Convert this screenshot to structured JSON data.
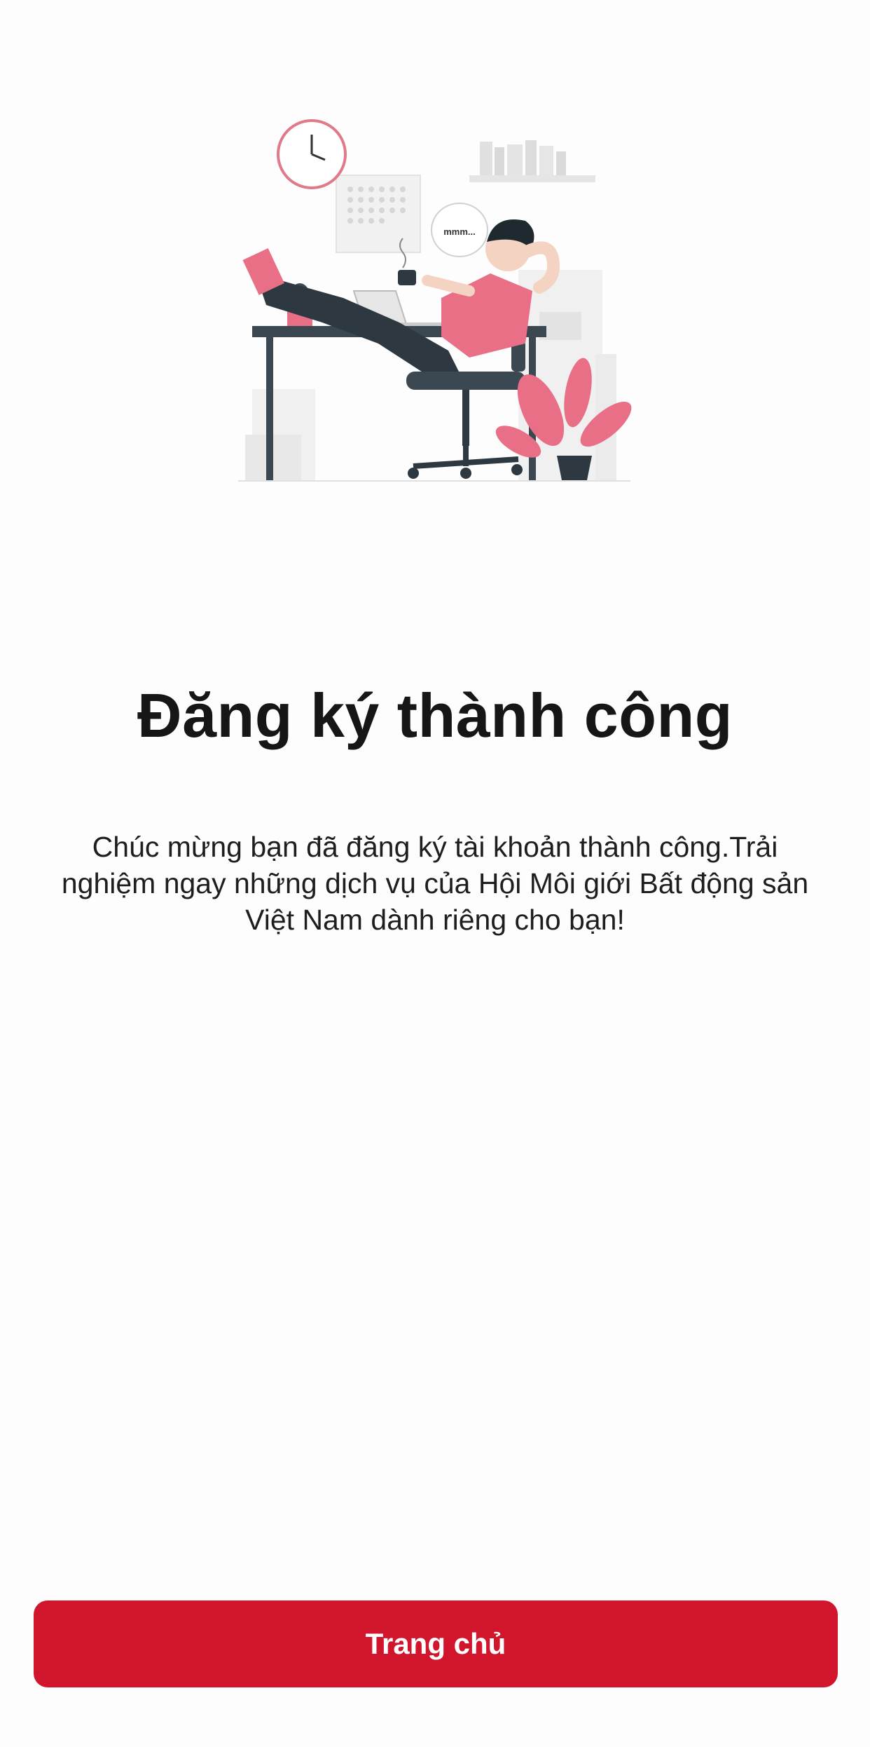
{
  "illustration": {
    "icon": "relaxing-person-at-desk-illustration",
    "speech_bubble_text": "mmm...",
    "accent_color": "#e86f85"
  },
  "success": {
    "title": "Đăng ký thành công",
    "message": "Chúc mừng bạn đã đăng ký tài khoản thành công.Trải nghiệm ngay những dịch vụ của Hội Môi giới Bất động sản Việt Nam dành riêng cho bạn!"
  },
  "actions": {
    "home_label": "Trang chủ",
    "primary_color": "#d0152c"
  }
}
